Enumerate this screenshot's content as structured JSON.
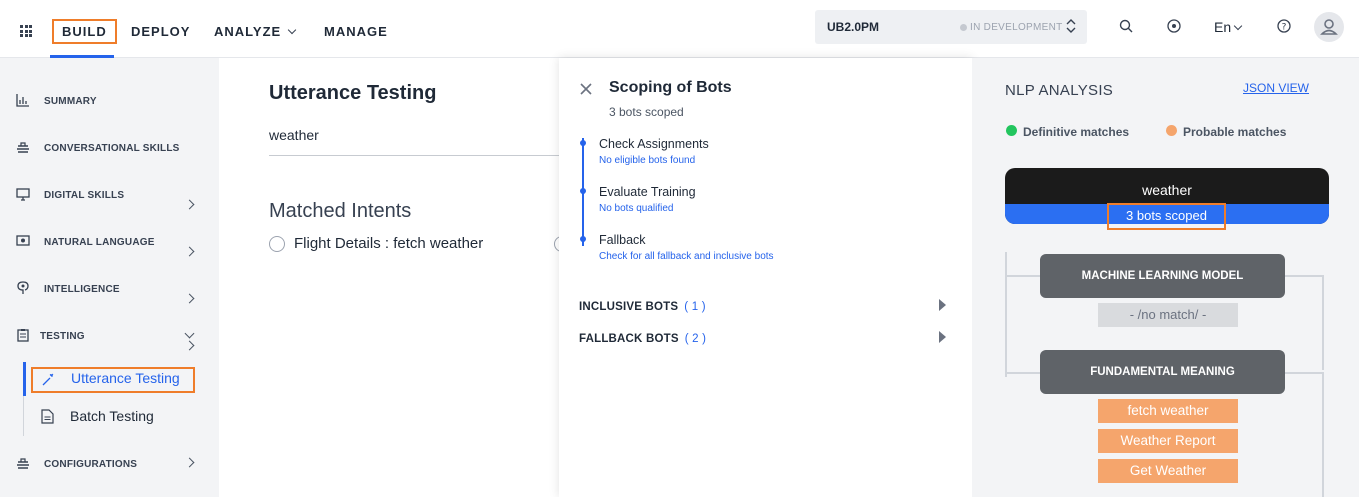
{
  "topbar": {
    "nav": [
      {
        "label": "BUILD",
        "active": true
      },
      {
        "label": "DEPLOY"
      },
      {
        "label": "ANALYZE"
      },
      {
        "label": "MANAGE"
      }
    ],
    "bot_name": "UB2.0PM",
    "bot_status": "IN DEVELOPMENT",
    "language": "En",
    "icons": [
      "apps-grid-icon",
      "search-icon",
      "tasks-icon",
      "help-icon",
      "user-icon"
    ]
  },
  "sidebar": {
    "items": [
      {
        "label": "SUMMARY",
        "icon": "chart-icon"
      },
      {
        "label": "CONVERSATIONAL SKILLS",
        "icon": "stack-icon"
      },
      {
        "label": "DIGITAL SKILLS",
        "icon": "monitor-icon"
      },
      {
        "label": "NATURAL LANGUAGE",
        "icon": "nlu-icon"
      },
      {
        "label": "INTELLIGENCE",
        "icon": "brain-icon"
      },
      {
        "label": "TESTING",
        "icon": "clipboard-icon"
      },
      {
        "label": "CONFIGURATIONS",
        "icon": "stack-icon"
      }
    ],
    "testing_sub": {
      "utterance": "Utterance Testing",
      "batch": "Batch Testing"
    }
  },
  "main": {
    "title": "Utterance Testing",
    "utterance_value": "weather",
    "matched_title": "Matched Intents",
    "intent_option": "Flight Details : fetch weather"
  },
  "panel": {
    "title": "Scoping of Bots",
    "subtitle": "3 bots scoped",
    "steps": [
      {
        "title": "Check Assignments",
        "desc": "No eligible bots found"
      },
      {
        "title": "Evaluate Training",
        "desc": "No bots qualified"
      },
      {
        "title": "Fallback",
        "desc": "Check for all fallback and inclusive bots"
      }
    ],
    "inclusive_label": "INCLUSIVE BOTS",
    "inclusive_count": "( 1 )",
    "fallback_label": "FALLBACK BOTS",
    "fallback_count": "( 2 )"
  },
  "nlp": {
    "title": "NLP ANALYSIS",
    "json_view": "JSON VIEW",
    "legend_definitive": "Definitive matches",
    "legend_probable": "Probable matches",
    "query": "weather",
    "scoped": "3 bots scoped",
    "ml_model": "MACHINE LEARNING MODEL",
    "ml_result": "- /no match/ -",
    "fm_model": "FUNDAMENTAL MEANING",
    "fm_results": [
      "fetch weather",
      "Weather Report",
      "Get Weather"
    ]
  },
  "colors": {
    "accent_blue": "#2563eb",
    "highlight_orange": "#ef7d2a",
    "definitive_green": "#22c55e",
    "probable_orange": "#f5a56c"
  }
}
